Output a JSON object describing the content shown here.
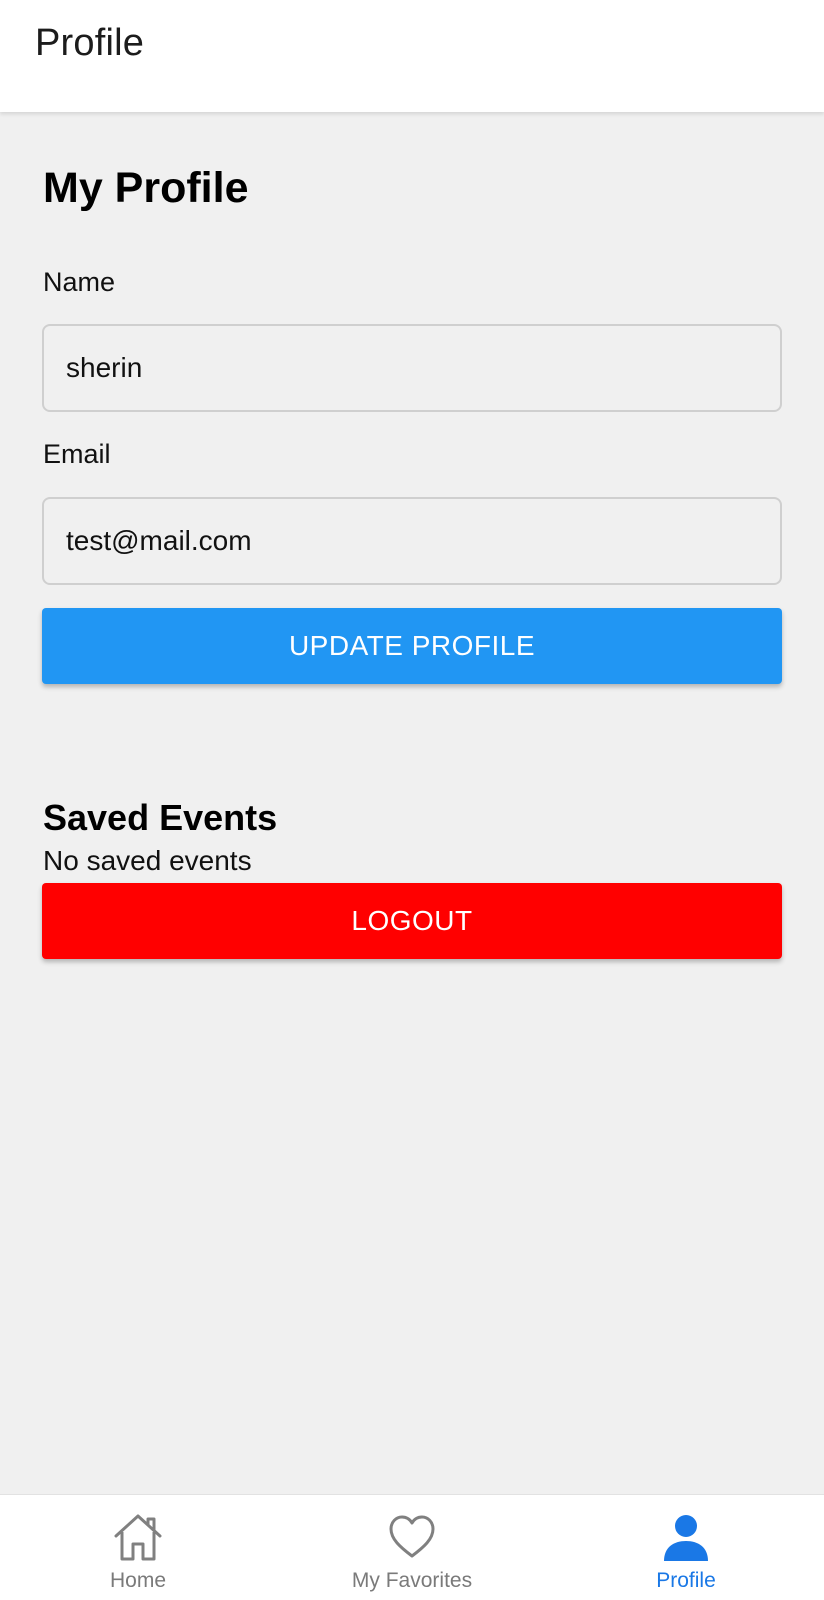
{
  "header": {
    "title": "Profile"
  },
  "main": {
    "page_title": "My Profile",
    "name_label": "Name",
    "name_value": "sherin",
    "email_label": "Email",
    "email_value": "test@mail.com",
    "update_button": "UPDATE PROFILE",
    "saved_events_title": "Saved Events",
    "saved_events_empty": "No saved events",
    "logout_button": "LOGOUT"
  },
  "bottom_nav": {
    "items": [
      {
        "label": "Home",
        "icon": "home-icon",
        "active": false
      },
      {
        "label": "My Favorites",
        "icon": "heart-icon",
        "active": false
      },
      {
        "label": "Profile",
        "icon": "person-icon",
        "active": true
      }
    ]
  },
  "colors": {
    "primary": "#2196f3",
    "danger": "#ff0000",
    "active_tab": "#1a78e6",
    "inactive_tab": "#7a7a7a",
    "background": "#f0f0f0"
  }
}
